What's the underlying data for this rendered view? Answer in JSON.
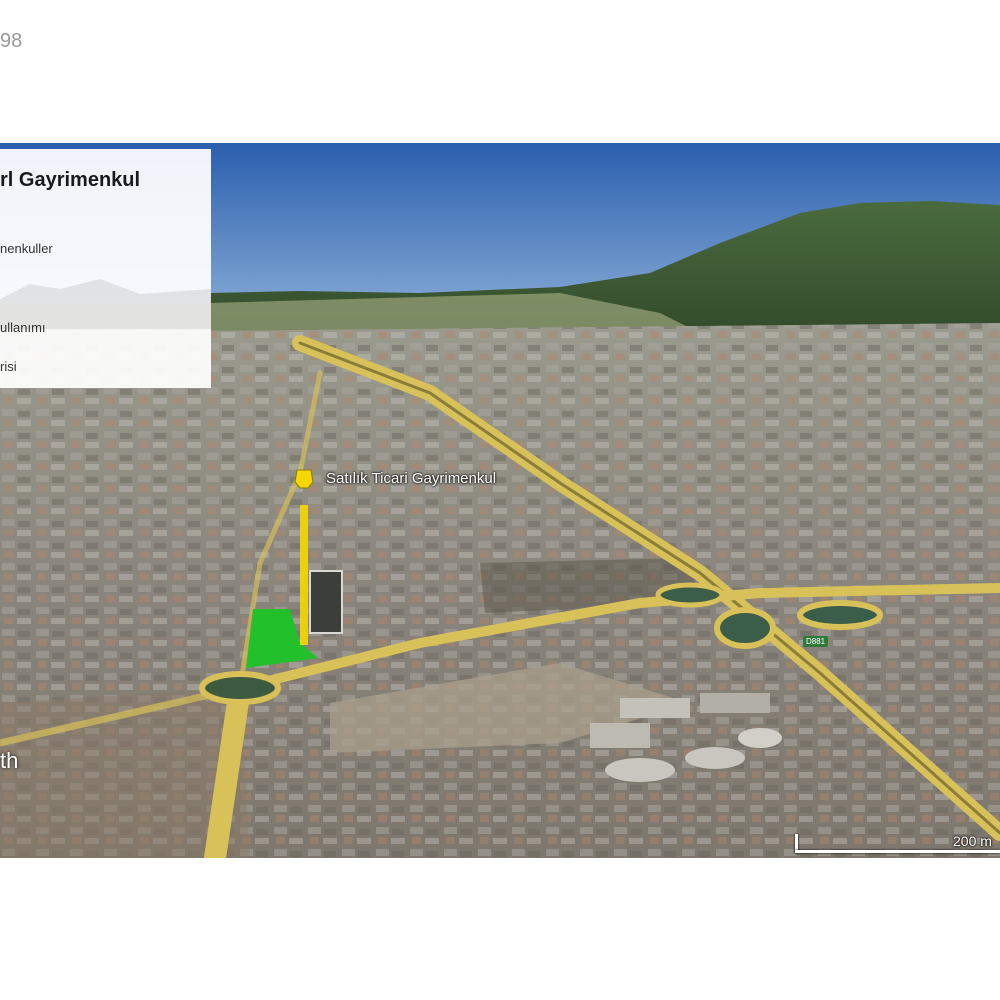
{
  "page": {
    "number_fragment": "98"
  },
  "legend": {
    "title_fragment": "rl Gayrimenkul",
    "items": [
      {
        "label_fragment": "nenkuller"
      },
      {
        "label_fragment": "ullanımı"
      },
      {
        "label_fragment": "risi"
      }
    ]
  },
  "map": {
    "place_label": "Satılık Ticari Gayrimenkul",
    "road_shield": "D881",
    "brand_fragment": "th",
    "scale_label": "200 m",
    "colors": {
      "sky": "#3a6fb8",
      "mountain": "#3d5a34",
      "urban": "#8f8c86",
      "road": "#d8c158",
      "parcel_highlight": "#22c02a",
      "marker_pin": "#f5d800"
    },
    "marker_icon": "map-pin-icon"
  }
}
